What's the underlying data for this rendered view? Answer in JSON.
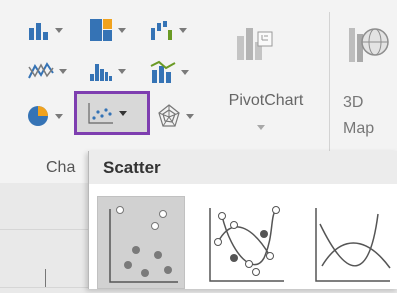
{
  "ribbon": {
    "group_label": "Cha",
    "pivot_label": "PivotChart",
    "map_label_1": "3D",
    "map_label_2": "Map",
    "icons": [
      "bar-chart-icon",
      "hierarchy-chart-icon",
      "waterfall-chart-icon",
      "line-chart-icon",
      "statistic-chart-icon",
      "combo-chart-icon",
      "pie-chart-icon",
      "scatter-chart-icon",
      "radar-chart-icon",
      "pivotchart-icon",
      "3d-map-icon"
    ],
    "selected_color": "#7e3eb0"
  },
  "popup": {
    "title": "Scatter",
    "thumbnails": [
      "scatter-icon",
      "scatter-smooth-lines-markers-icon",
      "scatter-smooth-lines-icon"
    ]
  }
}
